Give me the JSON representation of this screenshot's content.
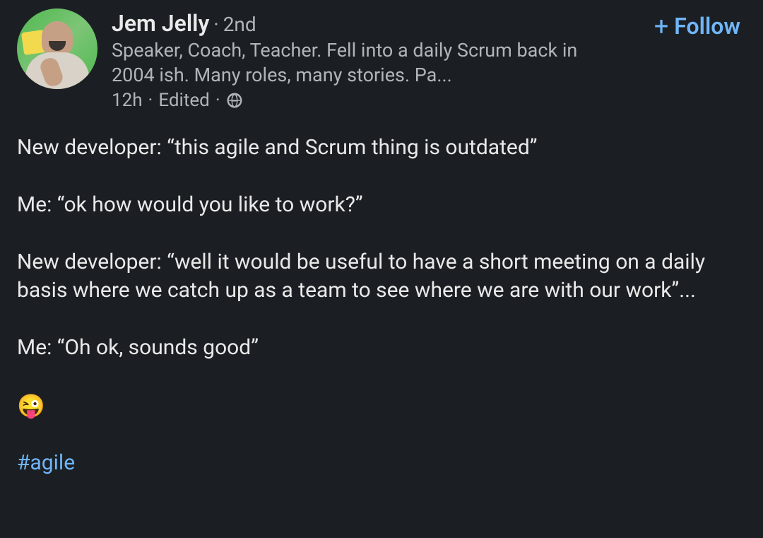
{
  "header": {
    "authorName": "Jem Jelly",
    "connectionDegree": "2nd",
    "headline": "Speaker, Coach, Teacher. Fell into a daily Scrum back in 2004 ish. Many roles, many stories. Pa...",
    "timestamp": "12h",
    "edited": "Edited",
    "visibility": "public"
  },
  "followButton": {
    "label": "Follow"
  },
  "body": {
    "line1": "New developer: “this agile and Scrum thing is outdated”",
    "line2": "Me: “ok how would you like to work?”",
    "line3": "New developer: “well it would be useful to have a short meeting on a daily basis where we catch up as a team to see where we are with our work”...",
    "line4": "Me: “Oh ok, sounds good”",
    "emoji": "😜",
    "hashtag": "#agile"
  },
  "separators": {
    "dot": "·"
  }
}
